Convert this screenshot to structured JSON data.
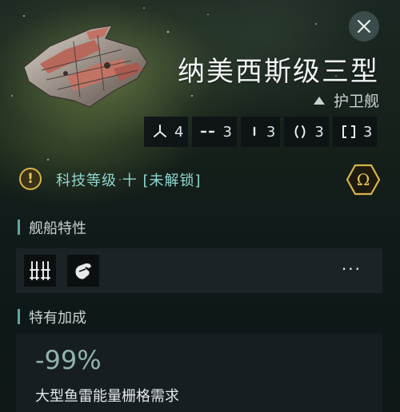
{
  "ship": {
    "name": "纳美西斯级三型",
    "class_label": "护卫舰"
  },
  "slots": [
    {
      "icon": "turret-hardpoint-icon",
      "count": "4"
    },
    {
      "icon": "high-slot-icon",
      "count": "3"
    },
    {
      "icon": "mid-slot-icon",
      "count": "3"
    },
    {
      "icon": "low-slot-icon",
      "count": "3"
    },
    {
      "icon": "rig-slot-icon",
      "count": "3"
    }
  ],
  "tech": {
    "label": "科技等级 十 [未解锁]",
    "warning_icon": "!",
    "omega_icon": "Ω"
  },
  "sections": {
    "traits_title": "舰船特性",
    "bonus_title": "特有加成"
  },
  "traits": {
    "items": [
      "torpedo-launcher-icon",
      "hand-grab-icon"
    ],
    "more_label": "···"
  },
  "bonus": {
    "value": "-99%",
    "description": "大型鱼雷能量栅格需求"
  },
  "colors": {
    "accent_teal": "#8fd8d0",
    "warning_gold": "#d7b54a",
    "section_bar": "#5fa8a4"
  }
}
